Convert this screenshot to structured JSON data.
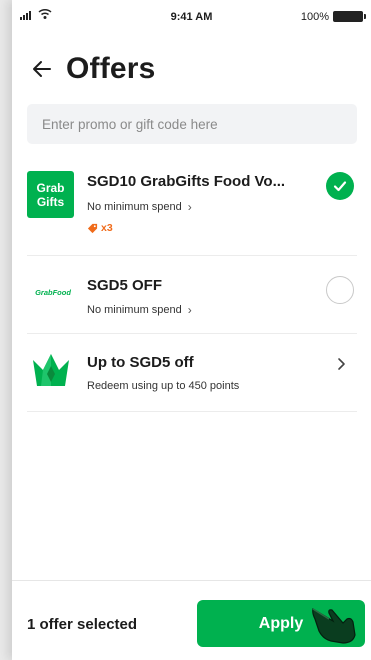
{
  "status_bar": {
    "time": "9:41 AM",
    "battery": "100%",
    "icons": [
      "signal-icon",
      "wifi-icon",
      "battery-icon"
    ]
  },
  "header": {
    "title": "Offers",
    "back_icon": "arrow-left-icon"
  },
  "promo_input": {
    "placeholder": "Enter promo or gift code here",
    "value": ""
  },
  "offers": [
    {
      "logo_lines": [
        "Grab",
        "Gifts"
      ],
      "title": "SGD10 GrabGifts Food Vo...",
      "subtitle": "No minimum spend",
      "subtitle_icon": "chevron-right-icon",
      "badge": "x3",
      "badge_icon": "tag-icon",
      "selected": true
    },
    {
      "logo_text": "GrabFood",
      "title": "SGD5 OFF",
      "subtitle": "No minimum spend",
      "subtitle_icon": "chevron-right-icon",
      "selected": false
    },
    {
      "logo_icon": "crown-icon",
      "title": "Up to SGD5 off",
      "subtitle": "Redeem using up to 450 points",
      "action_icon": "chevron-right-icon"
    }
  ],
  "footer": {
    "selected_text": "1 offer selected",
    "apply_label": "Apply",
    "pointer_icon": "hand-pointer-icon"
  },
  "colors": {
    "accent": "#00b14f",
    "badge": "#f06b1a",
    "input_bg": "#f2f3f5"
  }
}
